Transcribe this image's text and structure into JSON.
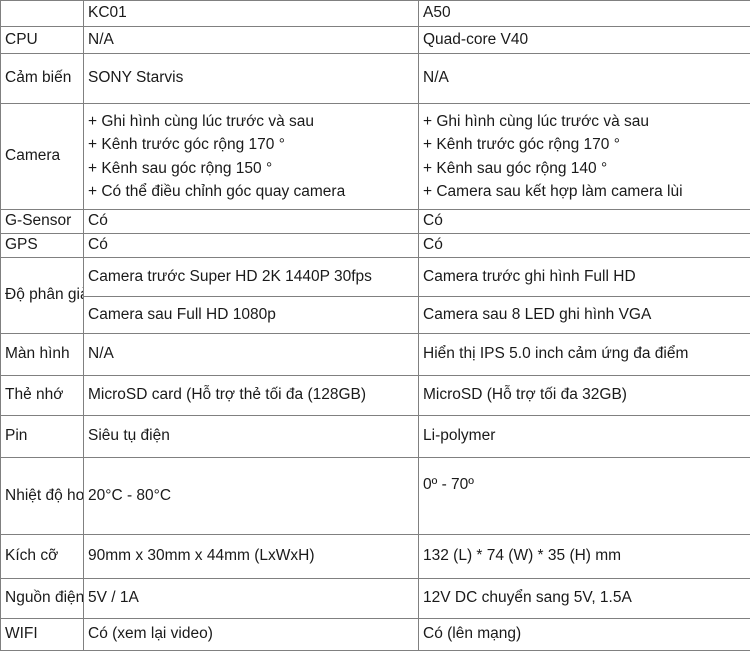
{
  "table": {
    "columns": [
      "",
      "KC01",
      "A50"
    ],
    "accent_color": "#1f6b42",
    "border_color": "#808080",
    "text_color": "#1a1a1a",
    "rows": [
      {
        "label": "",
        "kc01": "KC01",
        "a50": "A50"
      },
      {
        "label": "CPU",
        "kc01": "N/A",
        "a50": "Quad-core V40"
      },
      {
        "label": "Cảm biến",
        "kc01": "SONY Starvis",
        "a50": "N/A"
      },
      {
        "label": "Camera",
        "kc01_lines": [
          "+ Ghi hình cùng lúc trước và sau",
          "+ Kênh trước góc rộng 170 °",
          "+ Kênh sau góc rộng 150 °",
          "+ Có thể điều chỉnh góc quay camera"
        ],
        "a50_lines": [
          "+ Ghi hình cùng lúc trước và sau",
          "+ Kênh trước góc rộng 170 °",
          "+ Kênh sau góc rộng 140 °",
          "+ Camera sau kết hợp làm camera lùi"
        ]
      },
      {
        "label": "G-Sensor",
        "kc01": "Có",
        "a50": "Có"
      },
      {
        "label": "GPS",
        "kc01": "Có",
        "a50": "Có"
      },
      {
        "label": "Độ phân giải video",
        "kc01_a": "Camera trước Super HD 2K 1440P 30fps",
        "a50_a": "Camera trước ghi hình Full HD",
        "kc01_b": "Camera sau Full HD 1080p",
        "a50_b": "Camera sau 8 LED ghi hình VGA"
      },
      {
        "label": "Màn hình",
        "kc01": "N/A",
        "a50": "Hiển thị IPS 5.0 inch cảm ứng đa điểm"
      },
      {
        "label": "Thẻ nhớ",
        "kc01": "MicroSD card (Hỗ trợ thẻ tối đa (128GB)",
        "a50": "MicroSD (Hỗ trợ tối đa 32GB)"
      },
      {
        "label": "Pin",
        "kc01": "Siêu tụ điện",
        "a50": "Li-polymer"
      },
      {
        "label": "Nhiệt độ hoạt động",
        "kc01": "20°C - 80°C",
        "a50": "0º - 70º"
      },
      {
        "label": "Kích cỡ",
        "kc01": "90mm x 30mm x 44mm (LxWxH)",
        "a50": "132 (L) * 74 (W) * 35 (H) mm"
      },
      {
        "label": "Nguồn điện",
        "kc01": "5V / 1A",
        "a50": "12V DC  chuyển sang 5V, 1.5A"
      },
      {
        "label": "WIFI",
        "kc01": "Có (xem lại video)",
        "a50": "Có (lên mạng)"
      }
    ]
  }
}
